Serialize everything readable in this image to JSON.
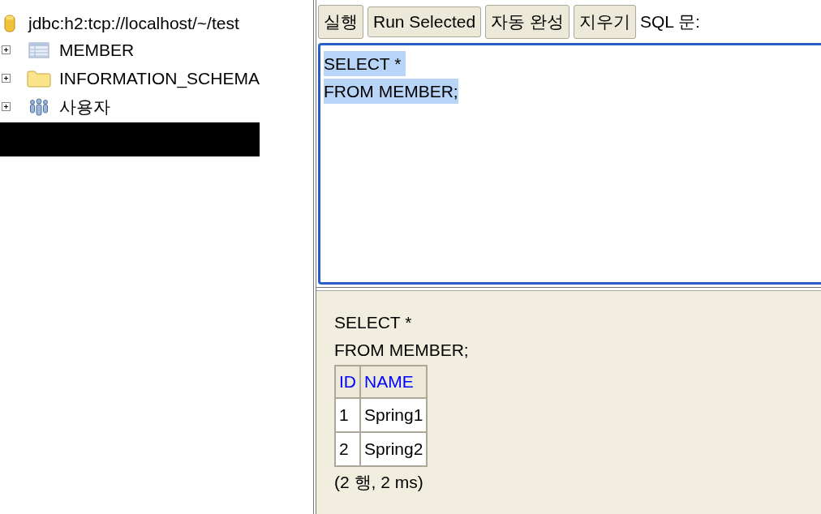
{
  "tree": {
    "connection": "jdbc:h2:tcp://localhost/~/test",
    "items": [
      {
        "kind": "table",
        "label": "MEMBER",
        "expanded": false
      },
      {
        "kind": "folder",
        "label": "INFORMATION_SCHEMA",
        "expanded": false
      },
      {
        "kind": "users",
        "label": "사용자",
        "expanded": false
      }
    ]
  },
  "toolbar": {
    "buttons": [
      "실행",
      "Run Selected",
      "자동 완성",
      "지우기"
    ],
    "label": "SQL 문:"
  },
  "sql_editor": {
    "lines": [
      "SELECT * ",
      "FROM MEMBER;"
    ],
    "selected": true
  },
  "result": {
    "query_lines": [
      "SELECT *",
      "FROM MEMBER;"
    ],
    "table": {
      "columns": [
        "ID",
        "NAME"
      ],
      "rows": [
        [
          "1",
          "Spring1"
        ],
        [
          "2",
          "Spring2"
        ]
      ]
    },
    "summary": "(2 행, 2 ms)"
  }
}
